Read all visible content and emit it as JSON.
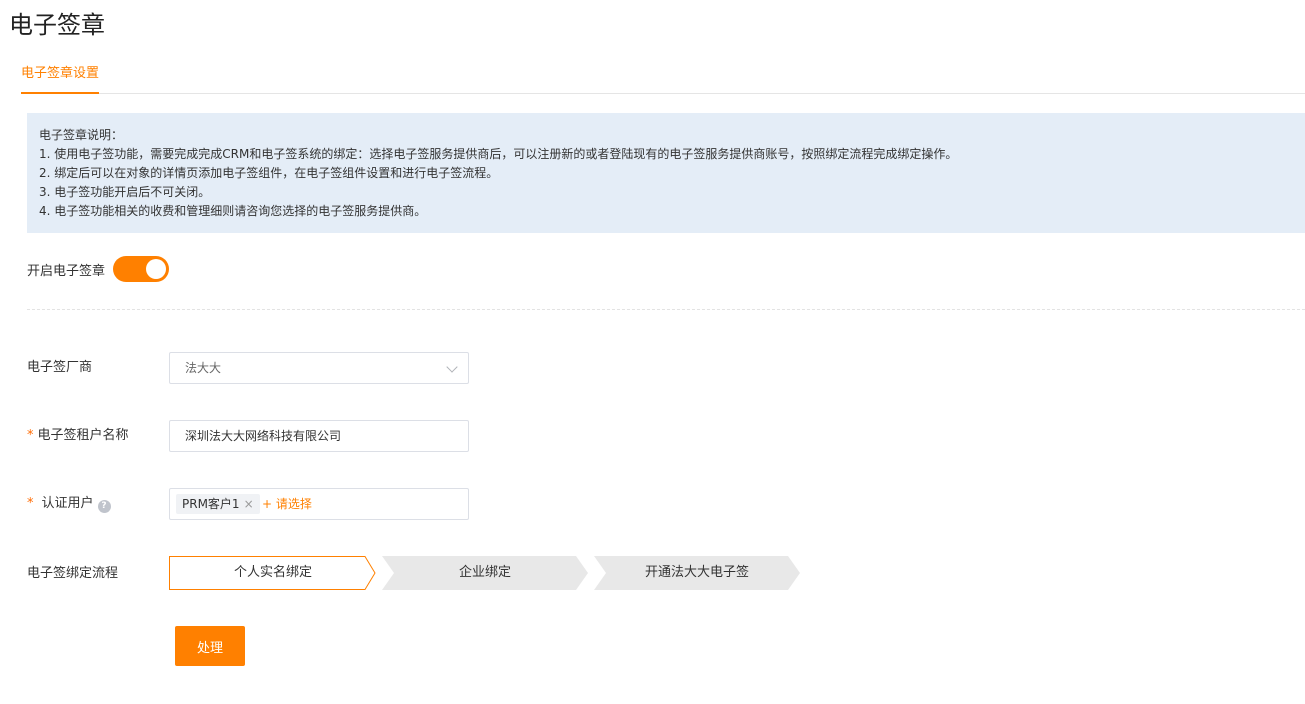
{
  "page": {
    "title": "电子签章"
  },
  "tabs": [
    {
      "label": "电子签章设置",
      "active": true
    }
  ],
  "notice": {
    "heading": "电子签章说明：",
    "lines": [
      "1. 使用电子签功能，需要完成完成CRM和电子签系统的绑定：选择电子签服务提供商后，可以注册新的或者登陆现有的电子签服务提供商账号，按照绑定流程完成绑定操作。",
      "2. 绑定后可以在对象的详情页添加电子签组件，在电子签组件设置和进行电子签流程。",
      "3. 电子签功能开启后不可关闭。",
      "4. 电子签功能相关的收费和管理细则请咨询您选择的电子签服务提供商。"
    ]
  },
  "switch": {
    "label": "开启电子签章",
    "on": true
  },
  "form": {
    "vendor": {
      "label": "电子签厂商",
      "value": "法大大"
    },
    "tenant": {
      "required_mark": "*",
      "label": "电子签租户名称",
      "value": "深圳法大大网络科技有限公司"
    },
    "auth_user": {
      "required_mark": "*",
      "label": "认证用户",
      "help_icon": "?",
      "tags": [
        "PRM客户1"
      ],
      "tag_close": "×",
      "add_label": "+ 请选择"
    },
    "flow": {
      "label": "电子签绑定流程",
      "steps": [
        "个人实名绑定",
        "企业绑定",
        "开通法大大电子签"
      ],
      "active_step": 0
    }
  },
  "actions": {
    "submit_label": "处理"
  },
  "colors": {
    "accent": "#ff8000",
    "notice_bg": "#e4edf7",
    "step_inactive": "#e8e8e8"
  }
}
